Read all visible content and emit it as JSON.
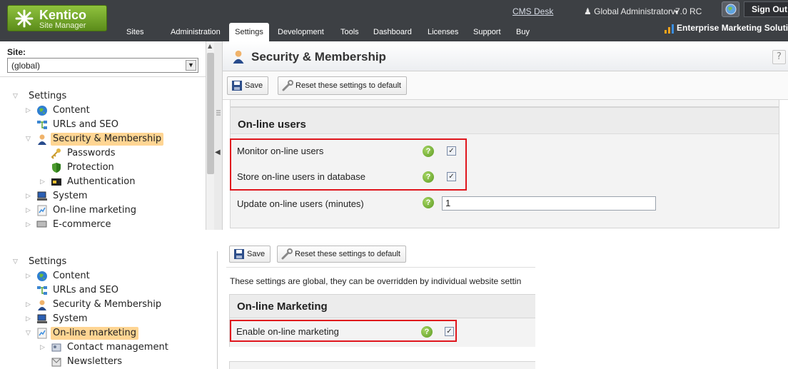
{
  "header": {
    "logo_title": "Kentico",
    "logo_subtitle": "Site Manager",
    "nav": [
      "Sites",
      "Administration",
      "Settings",
      "Development",
      "Tools",
      "Dashboard",
      "Licenses",
      "Support",
      "Buy"
    ],
    "active_tab": "Settings",
    "cms_desk": "CMS Desk",
    "user": "Global Administrator",
    "version": "v7.0 RC",
    "sign_out": "Sign Out",
    "edition": "Enterprise Marketing Solution"
  },
  "site_panel": {
    "label": "Site:",
    "selected": "(global)"
  },
  "tree_top": [
    {
      "label": "Settings",
      "icon": "none",
      "arrow": "expanded"
    },
    {
      "label": "Content",
      "icon": "globe-icon",
      "arrow": "collapsed"
    },
    {
      "label": "URLs and SEO",
      "icon": "sitemap-icon",
      "arrow": "none"
    },
    {
      "label": "Security & Membership",
      "icon": "user-icon",
      "arrow": "expanded",
      "selected": true
    },
    {
      "label": "Passwords",
      "icon": "key-icon",
      "arrow": "none"
    },
    {
      "label": "Protection",
      "icon": "shield-icon",
      "arrow": "none"
    },
    {
      "label": "Authentication",
      "icon": "auth-card-icon",
      "arrow": "collapsed"
    },
    {
      "label": "System",
      "icon": "computer-icon",
      "arrow": "collapsed"
    },
    {
      "label": "On-line marketing",
      "icon": "chart-icon",
      "arrow": "collapsed"
    },
    {
      "label": "E-commerce",
      "icon": "cart-icon",
      "arrow": "collapsed"
    }
  ],
  "main_top": {
    "title": "Security & Membership",
    "help": "?",
    "save_label": "Save",
    "reset_label": "Reset these settings to default",
    "section_title": "On-line users",
    "rows": [
      {
        "label": "Monitor on-line users",
        "checked": true,
        "mark": "✓"
      },
      {
        "label": "Store on-line users in database",
        "checked": true,
        "mark": "✓"
      },
      {
        "label": "Update on-line users (minutes)",
        "value": "1"
      }
    ]
  },
  "tree_bottom": [
    {
      "label": "Settings",
      "icon": "none",
      "arrow": "expanded"
    },
    {
      "label": "Content",
      "icon": "globe-icon",
      "arrow": "collapsed"
    },
    {
      "label": "URLs and SEO",
      "icon": "sitemap-icon",
      "arrow": "none"
    },
    {
      "label": "Security & Membership",
      "icon": "user-icon",
      "arrow": "collapsed"
    },
    {
      "label": "System",
      "icon": "computer-icon",
      "arrow": "collapsed"
    },
    {
      "label": "On-line marketing",
      "icon": "chart-icon",
      "arrow": "expanded",
      "selected": true
    },
    {
      "label": "Contact management",
      "icon": "contacts-icon",
      "arrow": "collapsed"
    },
    {
      "label": "Newsletters",
      "icon": "newsletter-icon",
      "arrow": "none"
    }
  ],
  "main_bottom": {
    "save_label": "Save",
    "reset_label": "Reset these settings to default",
    "notice": "These settings are global, they can be overridden by individual website settin",
    "section_title": "On-line Marketing",
    "rows": [
      {
        "label": "Enable on-line marketing",
        "checked": true,
        "mark": "✓"
      }
    ]
  },
  "colors": {
    "header_bg": "#3d4044",
    "logo_green": "#6fa52a",
    "selected_tree": "#ffd593",
    "highlight_red": "#e0161d",
    "help_green": "#7ab83a"
  }
}
